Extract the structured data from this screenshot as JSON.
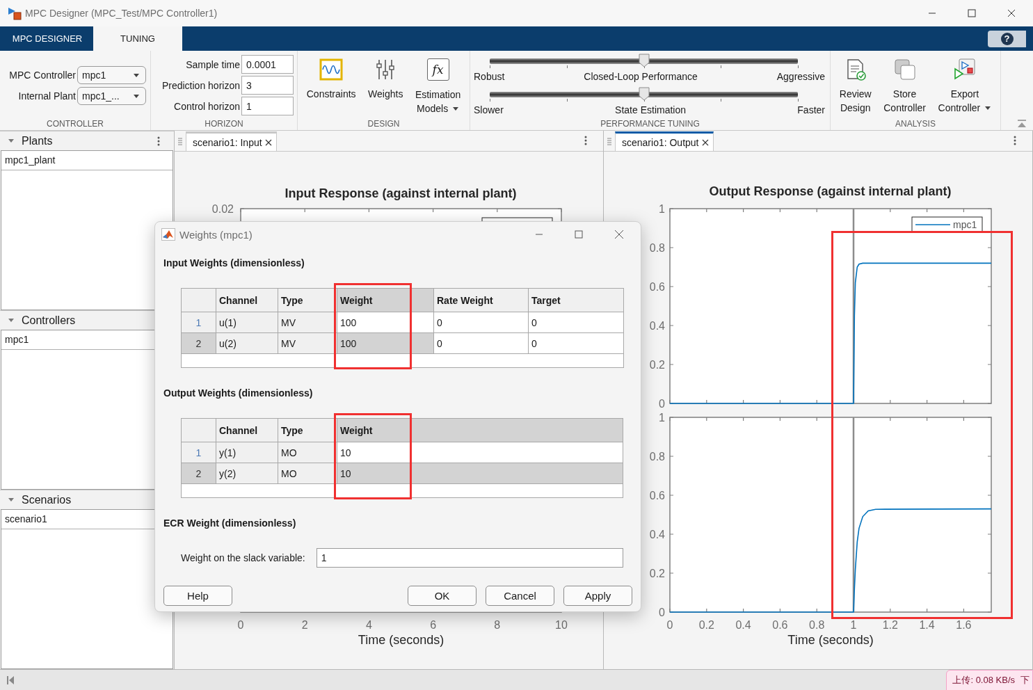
{
  "window": {
    "title": "MPC Designer (MPC_Test/MPC Controller1)"
  },
  "tabs": [
    {
      "label": "MPC DESIGNER",
      "selected": false
    },
    {
      "label": "TUNING",
      "selected": true
    }
  ],
  "help_button": {
    "label": "?"
  },
  "toolstrip": {
    "controller": {
      "label": "CONTROLLER",
      "fields": [
        {
          "label": "MPC Controller",
          "value": "mpc1"
        },
        {
          "label": "Internal Plant",
          "value": "mpc1_..."
        }
      ]
    },
    "horizon": {
      "label": "HORIZON",
      "fields": [
        {
          "label": "Sample time",
          "value": "0.0001"
        },
        {
          "label": "Prediction horizon",
          "value": "3"
        },
        {
          "label": "Control horizon",
          "value": "1"
        }
      ]
    },
    "design": {
      "label": "DESIGN",
      "buttons": [
        {
          "kind": "constraints",
          "lines": [
            "Constraints"
          ],
          "dropdown": false
        },
        {
          "kind": "weights",
          "lines": [
            "Weights"
          ],
          "dropdown": false
        },
        {
          "kind": "function",
          "icon_text": "fx",
          "lines": [
            "Estimation",
            "Models"
          ],
          "dropdown": true
        }
      ]
    },
    "performance": {
      "label": "PERFORMANCE TUNING",
      "sliders": [
        {
          "left": "Robust",
          "center": "Closed-Loop Performance",
          "right": "Aggressive",
          "level": 0.5
        },
        {
          "left": "Slower",
          "center": "State Estimation",
          "right": "Faster",
          "level": 0.5
        }
      ]
    },
    "analysis": {
      "label": "ANALYSIS",
      "buttons": [
        {
          "kind": "review",
          "lines": [
            "Review",
            "Design"
          ],
          "dropdown": false
        },
        {
          "kind": "store",
          "lines": [
            "Store",
            "Controller"
          ],
          "dropdown": false
        },
        {
          "kind": "export",
          "lines": [
            "Export",
            "Controller"
          ],
          "dropdown": true
        }
      ]
    }
  },
  "sidebar": {
    "sections": [
      {
        "title": "Plants",
        "expanded": true,
        "menu": true,
        "items": [
          "mpc1_plant"
        ]
      },
      {
        "title": "Controllers",
        "expanded": true,
        "menu": false,
        "items": [
          "mpc1"
        ]
      },
      {
        "title": "Scenarios",
        "expanded": true,
        "menu": false,
        "items": [
          "scenario1"
        ]
      }
    ]
  },
  "documents": [
    {
      "kind": "input",
      "tab": {
        "label": "scenario1: Input",
        "selected": false
      },
      "title": "Input Response (against internal plant)",
      "y_tick_labels": [
        "0.02"
      ],
      "x_tick_labels": [
        "0",
        "2",
        "4",
        "6",
        "8",
        "10"
      ],
      "xlabel": "Time (seconds)"
    },
    {
      "kind": "output",
      "tab": {
        "label": "scenario1: Output",
        "selected": true
      },
      "title": "Output Response (against internal plant)",
      "highlighted": true,
      "plots": [
        {
          "chart_data": {
            "type": "line",
            "x": [
              0,
              0.99,
              1,
              1.005,
              1.01,
              1.02,
              1.03,
              1.05,
              1.1,
              1.75
            ],
            "series": [
              {
                "name": "mpc1",
                "color": "#0072bd",
                "values": [
                  0,
                  0,
                  0,
                  0.45,
                  0.62,
                  0.7,
                  0.715,
                  0.72,
                  0.72,
                  0.72
                ]
              }
            ],
            "xlim": [
              0,
              1.75
            ],
            "ylim": [
              0,
              1
            ],
            "yticks": [
              0,
              0.2,
              0.4,
              0.6,
              0.8,
              1
            ],
            "ref_lines": [
              {
                "axis": "x",
                "value": 1
              }
            ]
          }
        },
        {
          "chart_data": {
            "type": "line",
            "xlabel": "Time (seconds)",
            "x": [
              0,
              0.99,
              1,
              1.005,
              1.01,
              1.02,
              1.03,
              1.05,
              1.08,
              1.12,
              1.75
            ],
            "series": [
              {
                "color": "#0072bd",
                "values": [
                  0,
                  0,
                  0,
                  0.12,
                  0.22,
                  0.36,
                  0.43,
                  0.49,
                  0.52,
                  0.528,
                  0.53
                ]
              }
            ],
            "xlim": [
              0,
              1.75
            ],
            "ylim": [
              0,
              1
            ],
            "xticks": [
              0,
              0.2,
              0.4,
              0.6,
              0.8,
              1,
              1.2,
              1.4,
              1.6
            ],
            "yticks": [
              0,
              0.2,
              0.4,
              0.6,
              0.8,
              1
            ],
            "ref_lines": [
              {
                "axis": "x",
                "value": 1
              }
            ]
          }
        }
      ]
    }
  ],
  "dialog": {
    "title": "Weights (mpc1)",
    "sections": [
      {
        "kind": "table",
        "heading": "Input Weights (dimensionless)",
        "columns": [
          {
            "label": "Channel",
            "editable": false,
            "selected": false,
            "highlighted": false
          },
          {
            "label": "Type",
            "editable": false,
            "selected": false,
            "highlighted": false
          },
          {
            "label": "Weight",
            "editable": true,
            "selected": true,
            "highlighted": true
          },
          {
            "label": "Rate Weight",
            "editable": true,
            "selected": false,
            "highlighted": false
          },
          {
            "label": "Target",
            "editable": true,
            "selected": false,
            "highlighted": false
          }
        ],
        "rows": [
          {
            "number": "1",
            "selected": false,
            "cells": [
              "u(1)",
              "MV",
              "100",
              "0",
              "0"
            ]
          },
          {
            "number": "2",
            "selected": true,
            "cells": [
              "u(2)",
              "MV",
              "100",
              "0",
              "0"
            ]
          }
        ]
      },
      {
        "kind": "table",
        "heading": "Output Weights (dimensionless)",
        "columns": [
          {
            "label": "Channel",
            "editable": false,
            "selected": false,
            "highlighted": false
          },
          {
            "label": "Type",
            "editable": false,
            "selected": false,
            "highlighted": false
          },
          {
            "label": "Weight",
            "editable": true,
            "selected": true,
            "highlighted": true
          }
        ],
        "rows": [
          {
            "number": "1",
            "selected": false,
            "cells": [
              "y(1)",
              "MO",
              "10"
            ]
          },
          {
            "number": "2",
            "selected": true,
            "cells": [
              "y(2)",
              "MO",
              "10"
            ]
          }
        ]
      },
      {
        "kind": "field",
        "heading": "ECR Weight (dimensionless)",
        "label": "Weight on the slack variable:",
        "value": "1"
      }
    ],
    "buttons_left": [
      "Help"
    ],
    "buttons_right": [
      "OK",
      "Cancel",
      "Apply"
    ]
  },
  "status_bar": {
    "network": [
      "上传: 0.08 KB/s",
      "下"
    ]
  }
}
